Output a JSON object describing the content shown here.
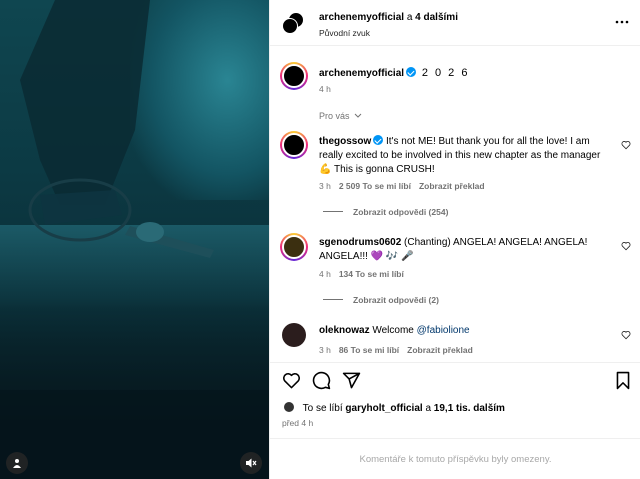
{
  "header": {
    "author": "archenemyofficial",
    "connector": "a",
    "others": "4 dalšími",
    "audio": "Původní zvuk"
  },
  "caption": {
    "author": "archenemyofficial",
    "text": "2 0 2 6",
    "time": "4 h"
  },
  "for_you_label": "Pro vás",
  "comments": [
    {
      "author": "thegossow",
      "verified": true,
      "text": "It's not ME! But thank you for all the love! I am really excited to be involved in this new chapter as the manager💪 This is gonna CRUSH!",
      "time": "3 h",
      "likes": "2 509 To se mi líbí",
      "translate": "Zobrazit překlad",
      "replies": "Zobrazit odpovědi (254)"
    },
    {
      "author": "sgenodrums0602",
      "verified": false,
      "text": "(Chanting) ANGELA! ANGELA! ANGELA! ANGELA!!! 💜 🎶 🎤",
      "time": "4 h",
      "likes": "134 To se mi líbí",
      "translate": "",
      "replies": "Zobrazit odpovědi (2)"
    },
    {
      "author": "oleknowaz",
      "verified": false,
      "text_prefix": "Welcome",
      "mention": "@fabiolione",
      "time": "3 h",
      "likes": "86 To se mi líbí",
      "translate": "Zobrazit překlad"
    }
  ],
  "liked_by": {
    "prefix": "To se líbí",
    "user": "garyholt_official",
    "connector": "a",
    "count": "19,1 tis. dalším"
  },
  "posted_ago": "před 4 h",
  "comments_limited": "Komentáře k tomuto příspěvku byly omezeny.",
  "icons": {
    "like": "heart-icon",
    "comment": "comment-icon",
    "share": "share-icon",
    "save": "bookmark-icon",
    "more": "more-icon",
    "mute": "speaker-muted-icon",
    "tagged": "user-icon"
  },
  "colors": {
    "verified": "#0095f6",
    "muted_text": "#737373",
    "mention": "#00376b"
  }
}
